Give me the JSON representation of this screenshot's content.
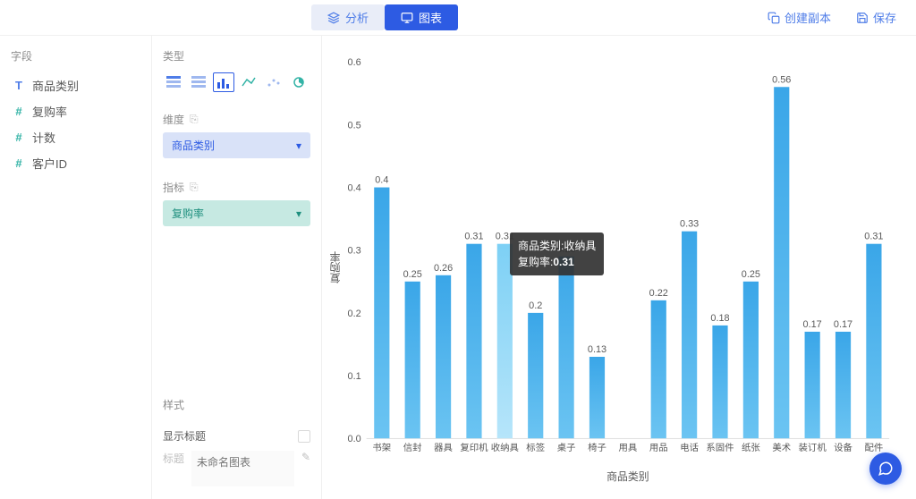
{
  "header": {
    "tab_analysis": "分析",
    "tab_chart": "图表",
    "btn_copy": "创建副本",
    "btn_save": "保存"
  },
  "fields": {
    "title": "字段",
    "items": [
      {
        "icon": "T",
        "label": "商品类别"
      },
      {
        "icon": "#",
        "label": "复购率"
      },
      {
        "icon": "#",
        "label": "计数"
      },
      {
        "icon": "#",
        "label": "客户ID"
      }
    ]
  },
  "chart_types": {
    "title": "类型"
  },
  "dimension": {
    "title": "维度",
    "item": "商品类别"
  },
  "metric": {
    "title": "指标",
    "item": "复购率"
  },
  "style": {
    "title": "样式",
    "show_title": "显示标题",
    "title_label": "标题",
    "title_placeholder": "未命名图表"
  },
  "tooltip": {
    "l1k": "商品类别:",
    "l1v": "收纳具",
    "l2k": "复购率:",
    "l2v": "0.31"
  },
  "chart_data": {
    "type": "bar",
    "title": "",
    "xlabel": "商品类别",
    "ylabel": "复购率",
    "ylim": [
      0,
      0.6
    ],
    "categories": [
      "书架",
      "信封",
      "器具",
      "复印机",
      "收纳具",
      "标签",
      "桌子",
      "椅子",
      "用具",
      "用品",
      "电话",
      "系固件",
      "纸张",
      "美术",
      "装订机",
      "设备",
      "配件"
    ],
    "values": [
      0.4,
      0.25,
      0.26,
      0.31,
      0.31,
      0.2,
      0.29,
      0.13,
      0,
      0.22,
      0.33,
      0.18,
      0.25,
      0.56,
      0.17,
      0.17,
      0.31
    ],
    "highlight": 4
  }
}
